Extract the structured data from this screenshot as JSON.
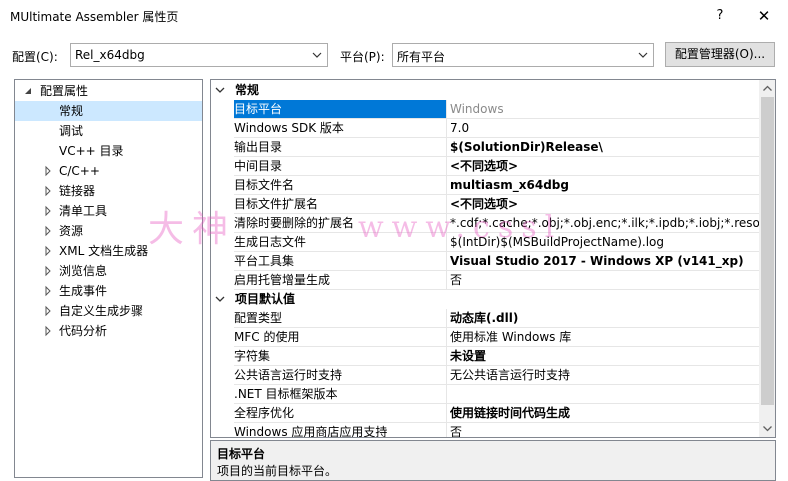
{
  "window": {
    "title": "MUltimate Assembler 属性页",
    "help_label": "?",
    "close_label": "✕"
  },
  "toolbar": {
    "config_label": "配置(C):",
    "config_value": "Rel_x64dbg",
    "platform_label": "平台(P):",
    "platform_value": "所有平台",
    "manager_button": "配置管理器(O)..."
  },
  "tree": {
    "items": [
      {
        "label": "配置属性",
        "state": "expanded"
      },
      {
        "label": "常规",
        "state": "leaf",
        "selected": true
      },
      {
        "label": "调试",
        "state": "leaf"
      },
      {
        "label": "VC++ 目录",
        "state": "leaf"
      },
      {
        "label": "C/C++",
        "state": "collapsed"
      },
      {
        "label": "链接器",
        "state": "collapsed"
      },
      {
        "label": "清单工具",
        "state": "collapsed"
      },
      {
        "label": "资源",
        "state": "collapsed"
      },
      {
        "label": "XML 文档生成器",
        "state": "collapsed"
      },
      {
        "label": "浏览信息",
        "state": "collapsed"
      },
      {
        "label": "生成事件",
        "state": "collapsed"
      },
      {
        "label": "自定义生成步骤",
        "state": "collapsed"
      },
      {
        "label": "代码分析",
        "state": "collapsed"
      }
    ]
  },
  "grid": {
    "categories": [
      {
        "label": "常规",
        "rows": [
          {
            "name": "目标平台",
            "value": "Windows",
            "style": "gray",
            "selected": true
          },
          {
            "name": "Windows SDK 版本",
            "value": "7.0",
            "style": "normal"
          },
          {
            "name": "输出目录",
            "value": "$(SolutionDir)Release\\",
            "style": "bold"
          },
          {
            "name": "中间目录",
            "value": "<不同选项>",
            "style": "bold"
          },
          {
            "name": "目标文件名",
            "value": "multiasm_x64dbg",
            "style": "bold"
          },
          {
            "name": "目标文件扩展名",
            "value": "<不同选项>",
            "style": "bold"
          },
          {
            "name": "清除时要删除的扩展名",
            "value": "*.cdf;*.cache;*.obj;*.obj.enc;*.ilk;*.ipdb;*.iobj;*.resources;",
            "style": "normal"
          },
          {
            "name": "生成日志文件",
            "value": "$(IntDir)$(MSBuildProjectName).log",
            "style": "normal"
          },
          {
            "name": "平台工具集",
            "value": "Visual Studio 2017 - Windows XP (v141_xp)",
            "style": "bold"
          },
          {
            "name": "启用托管增量生成",
            "value": "否",
            "style": "normal"
          }
        ]
      },
      {
        "label": "项目默认值",
        "rows": [
          {
            "name": "配置类型",
            "value": "动态库(.dll)",
            "style": "bold"
          },
          {
            "name": "MFC 的使用",
            "value": "使用标准 Windows 库",
            "style": "normal"
          },
          {
            "name": "字符集",
            "value": "未设置",
            "style": "bold"
          },
          {
            "name": "公共语言运行时支持",
            "value": "无公共语言运行时支持",
            "style": "normal"
          },
          {
            "name": ".NET 目标框架版本",
            "value": "",
            "style": "normal"
          },
          {
            "name": "全程序优化",
            "value": "使用链接时间代码生成",
            "style": "bold"
          },
          {
            "name": "Windows 应用商店应用支持",
            "value": "否",
            "style": "normal"
          }
        ]
      }
    ]
  },
  "description": {
    "title": "目标平台",
    "text": "项目的当前目标平台。"
  },
  "watermark": {
    "left": "大神",
    "right": "www.cssl"
  },
  "colors": {
    "selection": "#0078d7",
    "tree_selection": "#cce8ff",
    "watermark": "#e650be"
  }
}
